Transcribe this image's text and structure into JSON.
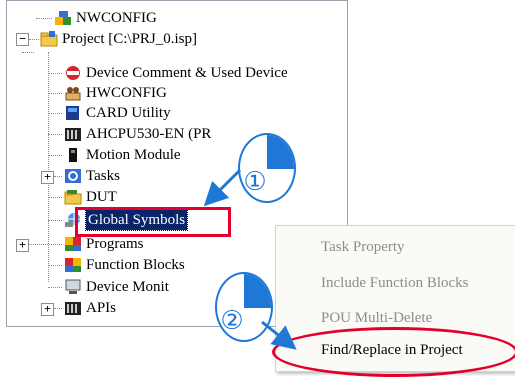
{
  "tree": {
    "items": [
      {
        "label": "NWCONFIG",
        "icon": "network-config-icon"
      },
      {
        "label": "Project [C:\\PRJ_0.isp]",
        "icon": "project-folder-icon",
        "expander": "−"
      },
      {
        "label": "Device Comment & Used Device",
        "icon": "device-comment-icon"
      },
      {
        "label": "HWCONFIG",
        "icon": "hardware-config-icon"
      },
      {
        "label": "CARD Utility",
        "icon": "card-utility-icon"
      },
      {
        "label": "AHCPU530-EN  (PR",
        "icon": "cpu-module-icon"
      },
      {
        "label": "Motion Module",
        "icon": "motion-module-icon"
      },
      {
        "label": "Tasks",
        "icon": "tasks-icon",
        "expander": "+"
      },
      {
        "label": "DUT",
        "icon": "dut-folder-icon"
      },
      {
        "label": "Global Symbols",
        "icon": "global-symbols-icon"
      },
      {
        "label": "Programs",
        "icon": "programs-icon",
        "expander": "+"
      },
      {
        "label": "Function Blocks",
        "icon": "function-blocks-icon"
      },
      {
        "label": "Device Monit",
        "icon": "device-monitor-icon"
      },
      {
        "label": "APIs",
        "icon": "apis-icon",
        "expander": "+"
      }
    ]
  },
  "context_menu": {
    "items": [
      {
        "label": "Task Property",
        "enabled": false
      },
      {
        "label": "Include Function Blocks",
        "enabled": false
      },
      {
        "label": "POU Multi-Delete",
        "enabled": false
      },
      {
        "label": "Find/Replace in Project",
        "enabled": true
      }
    ]
  },
  "callouts": {
    "step1": "①",
    "step2": "②"
  },
  "colors": {
    "callout_blue": "#1f78d6",
    "highlight_red": "#e4002b",
    "selection_navy": "#0a246a"
  }
}
